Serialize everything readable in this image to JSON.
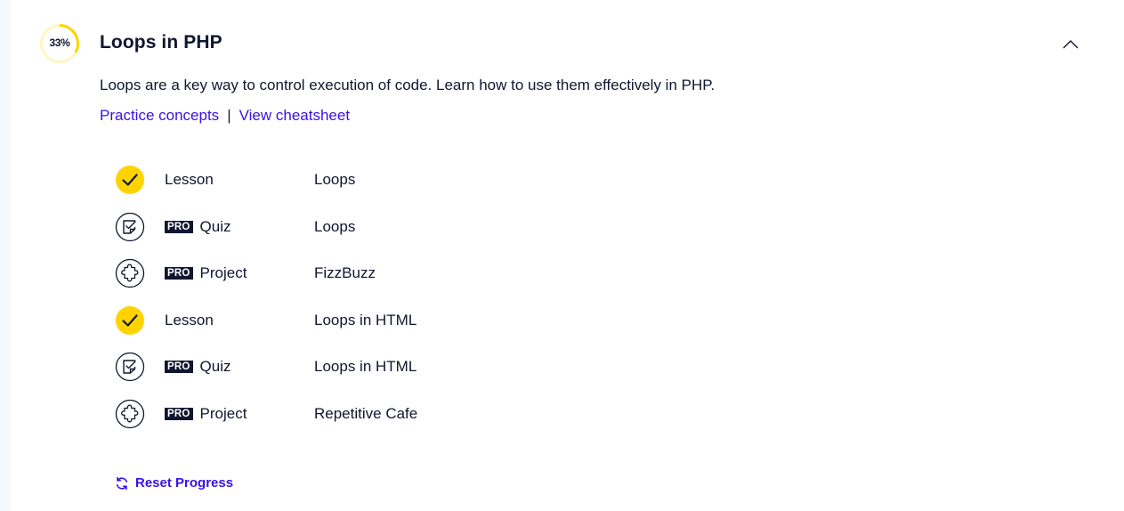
{
  "module": {
    "progress_text": "33%",
    "progress_value": 33,
    "title": "Loops in PHP",
    "description": "Loops are a key way to control execution of code. Learn how to use them effectively in PHP.",
    "links": {
      "practice": "Practice concepts",
      "separator": "|",
      "cheatsheet": "View cheatsheet"
    },
    "items": [
      {
        "status": "completed",
        "icon": "check-icon",
        "pro": false,
        "type": "Lesson",
        "name": "Loops"
      },
      {
        "status": "locked",
        "icon": "quiz-icon",
        "pro": true,
        "type": "Quiz",
        "name": "Loops"
      },
      {
        "status": "locked",
        "icon": "puzzle-icon",
        "pro": true,
        "type": "Project",
        "name": "FizzBuzz"
      },
      {
        "status": "completed",
        "icon": "check-icon",
        "pro": false,
        "type": "Lesson",
        "name": "Loops in HTML"
      },
      {
        "status": "locked",
        "icon": "quiz-icon",
        "pro": true,
        "type": "Quiz",
        "name": "Loops in HTML"
      },
      {
        "status": "locked",
        "icon": "puzzle-icon",
        "pro": true,
        "type": "Project",
        "name": "Repetitive Cafe"
      }
    ],
    "pro_label": "PRO",
    "reset_label": "Reset Progress"
  },
  "colors": {
    "accent": "#3a10e5",
    "progress": "#ffd300",
    "progress_track": "#fff6c2",
    "text": "#10162f"
  }
}
